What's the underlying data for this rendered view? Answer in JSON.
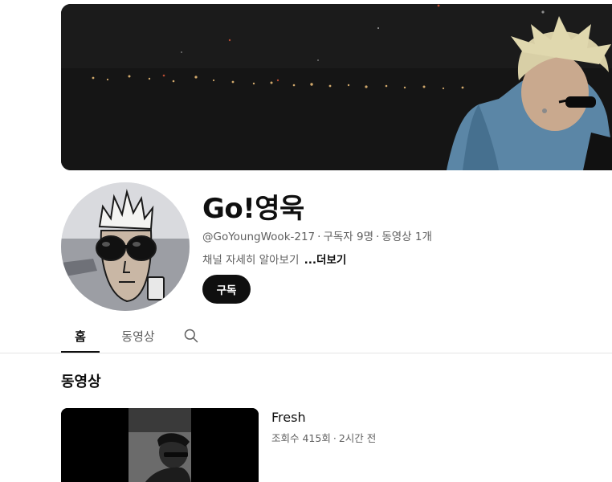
{
  "channel": {
    "name": "Go!영욱",
    "handle": "@GoYoungWook-217",
    "subscribers": "구독자 9명",
    "video_count": "동영상 1개",
    "separator": "·",
    "description": "채널 자세히 알아보기",
    "more_label": "...더보기",
    "subscribe_label": "구독"
  },
  "tabs": [
    {
      "label": "홈",
      "active": true
    },
    {
      "label": "동영상",
      "active": false
    }
  ],
  "section": {
    "title": "동영상"
  },
  "videos": [
    {
      "title": "Fresh",
      "views": "조회수 415회",
      "age": "2시간 전"
    }
  ],
  "icons": {
    "search": "search-icon"
  },
  "colors": {
    "text_primary": "#0f0f0f",
    "text_secondary": "#606060",
    "subscribe_bg": "#0f0f0f",
    "divider": "#e5e5e5"
  }
}
